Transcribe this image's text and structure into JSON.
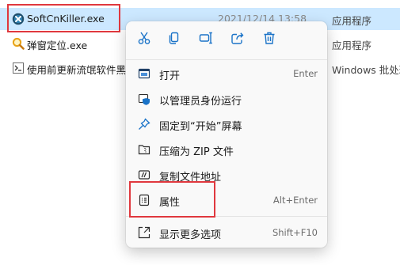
{
  "files": [
    {
      "name": "SoftCnKiller.exe",
      "date": "2021/12/14 13:58",
      "type": "应用程序",
      "icon": "softcnkiller-app-icon",
      "selected": true
    },
    {
      "name": "弹窗定位.exe",
      "date": "",
      "type": "应用程序",
      "icon": "magnifier-app-icon",
      "selected": false
    },
    {
      "name": "使用前更新流氓软件黑名",
      "date": "",
      "type": "Windows 批处理",
      "icon": "batch-file-icon",
      "selected": false
    }
  ],
  "context_menu": {
    "quick_actions": [
      "cut-icon",
      "copy-icon",
      "rename-icon",
      "share-icon",
      "delete-icon"
    ],
    "items": [
      {
        "icon": "open-icon",
        "label": "打开",
        "shortcut": "Enter"
      },
      {
        "icon": "admin-shield-icon",
        "label": "以管理员身份运行",
        "shortcut": ""
      },
      {
        "icon": "pin-icon",
        "label": "固定到“开始”屏幕",
        "shortcut": ""
      },
      {
        "icon": "zip-icon",
        "label": "压缩为 ZIP 文件",
        "shortcut": ""
      },
      {
        "icon": "copy-path-icon",
        "label": "复制文件地址",
        "shortcut": ""
      },
      {
        "icon": "properties-icon",
        "label": "属性",
        "shortcut": "Alt+Enter"
      },
      {
        "icon": "more-options-icon",
        "label": "显示更多选项",
        "shortcut": "Shift+F10"
      }
    ]
  },
  "colors": {
    "selection": "#cce8ff",
    "highlight_box": "#e0383e",
    "accent": "#1a73c8"
  }
}
